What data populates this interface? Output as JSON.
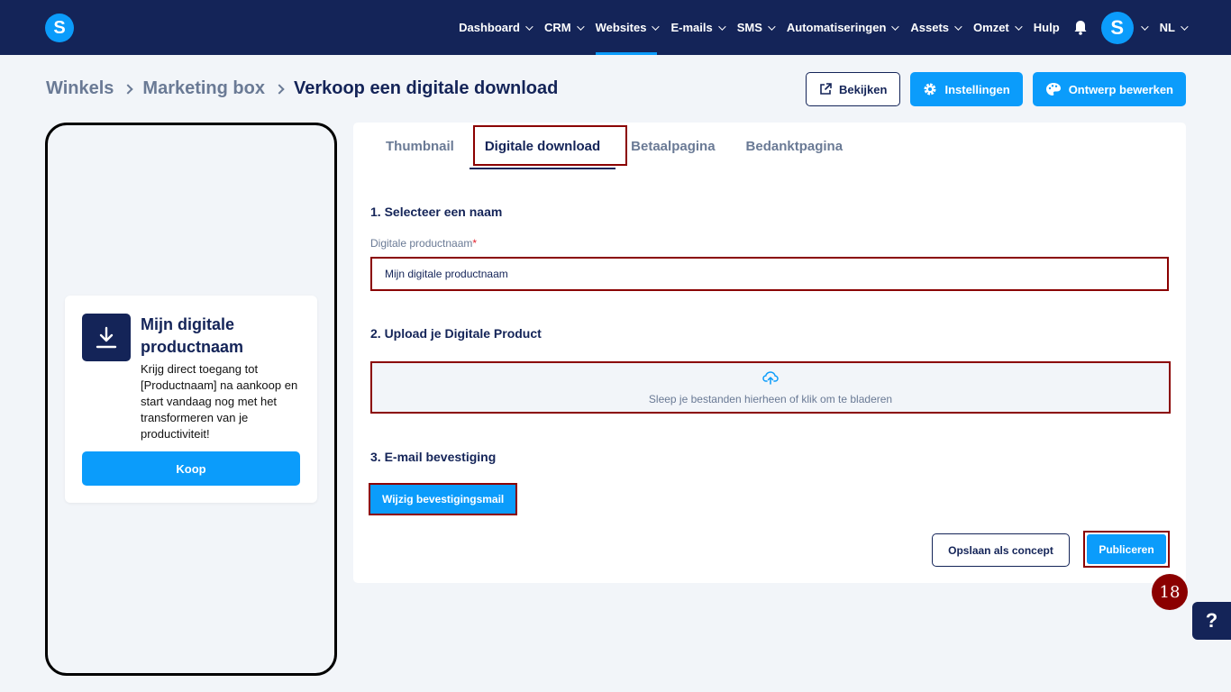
{
  "nav": {
    "logo": "S",
    "items": [
      {
        "label": "Dashboard"
      },
      {
        "label": "CRM"
      },
      {
        "label": "Websites"
      },
      {
        "label": "E-mails"
      },
      {
        "label": "SMS"
      },
      {
        "label": "Automatiseringen"
      },
      {
        "label": "Assets"
      },
      {
        "label": "Omzet"
      }
    ],
    "help_link": "Hulp",
    "avatar": "S",
    "language": "NL",
    "active_item": "Websites",
    "bell_icon": "bell-icon"
  },
  "breadcrumb": {
    "items": [
      "Winkels",
      "Marketing box"
    ],
    "current": "Verkoop een digitale download"
  },
  "header_actions": {
    "view_label": "Bekijken",
    "settings_label": "Instellingen",
    "design_label": "Ontwerp bewerken"
  },
  "preview": {
    "title": "Mijn digitale productnaam",
    "description": "Krijg direct toegang tot [Productnaam] na aankoop en start vandaag nog met het transformeren van je productiviteit!",
    "buy_label": "Koop",
    "icon": "download-icon"
  },
  "tabs": [
    {
      "label": "Thumbnail"
    },
    {
      "label": "Digitale download"
    },
    {
      "label": "Betaalpagina"
    },
    {
      "label": "Bedanktpagina"
    }
  ],
  "active_tab": "Digitale download",
  "form": {
    "section1_title": "1. Selecteer een naam",
    "name_label": "Digitale productnaam",
    "name_required": "*",
    "name_value": "Mijn digitale productnaam",
    "section2_title": "2. Upload je Digitale Product",
    "upload_text": "Sleep je bestanden hierheen of klik om te bladeren",
    "section3_title": "3. E-mail bevestiging",
    "mail_button": "Wijzig bevestigingsmail",
    "save_draft": "Opslaan als concept",
    "publish": "Publiceren"
  },
  "marker": "18",
  "help_button": "?",
  "colors": {
    "navy": "#142458",
    "accent": "#0b9cfb",
    "highlight": "#8b0000"
  }
}
